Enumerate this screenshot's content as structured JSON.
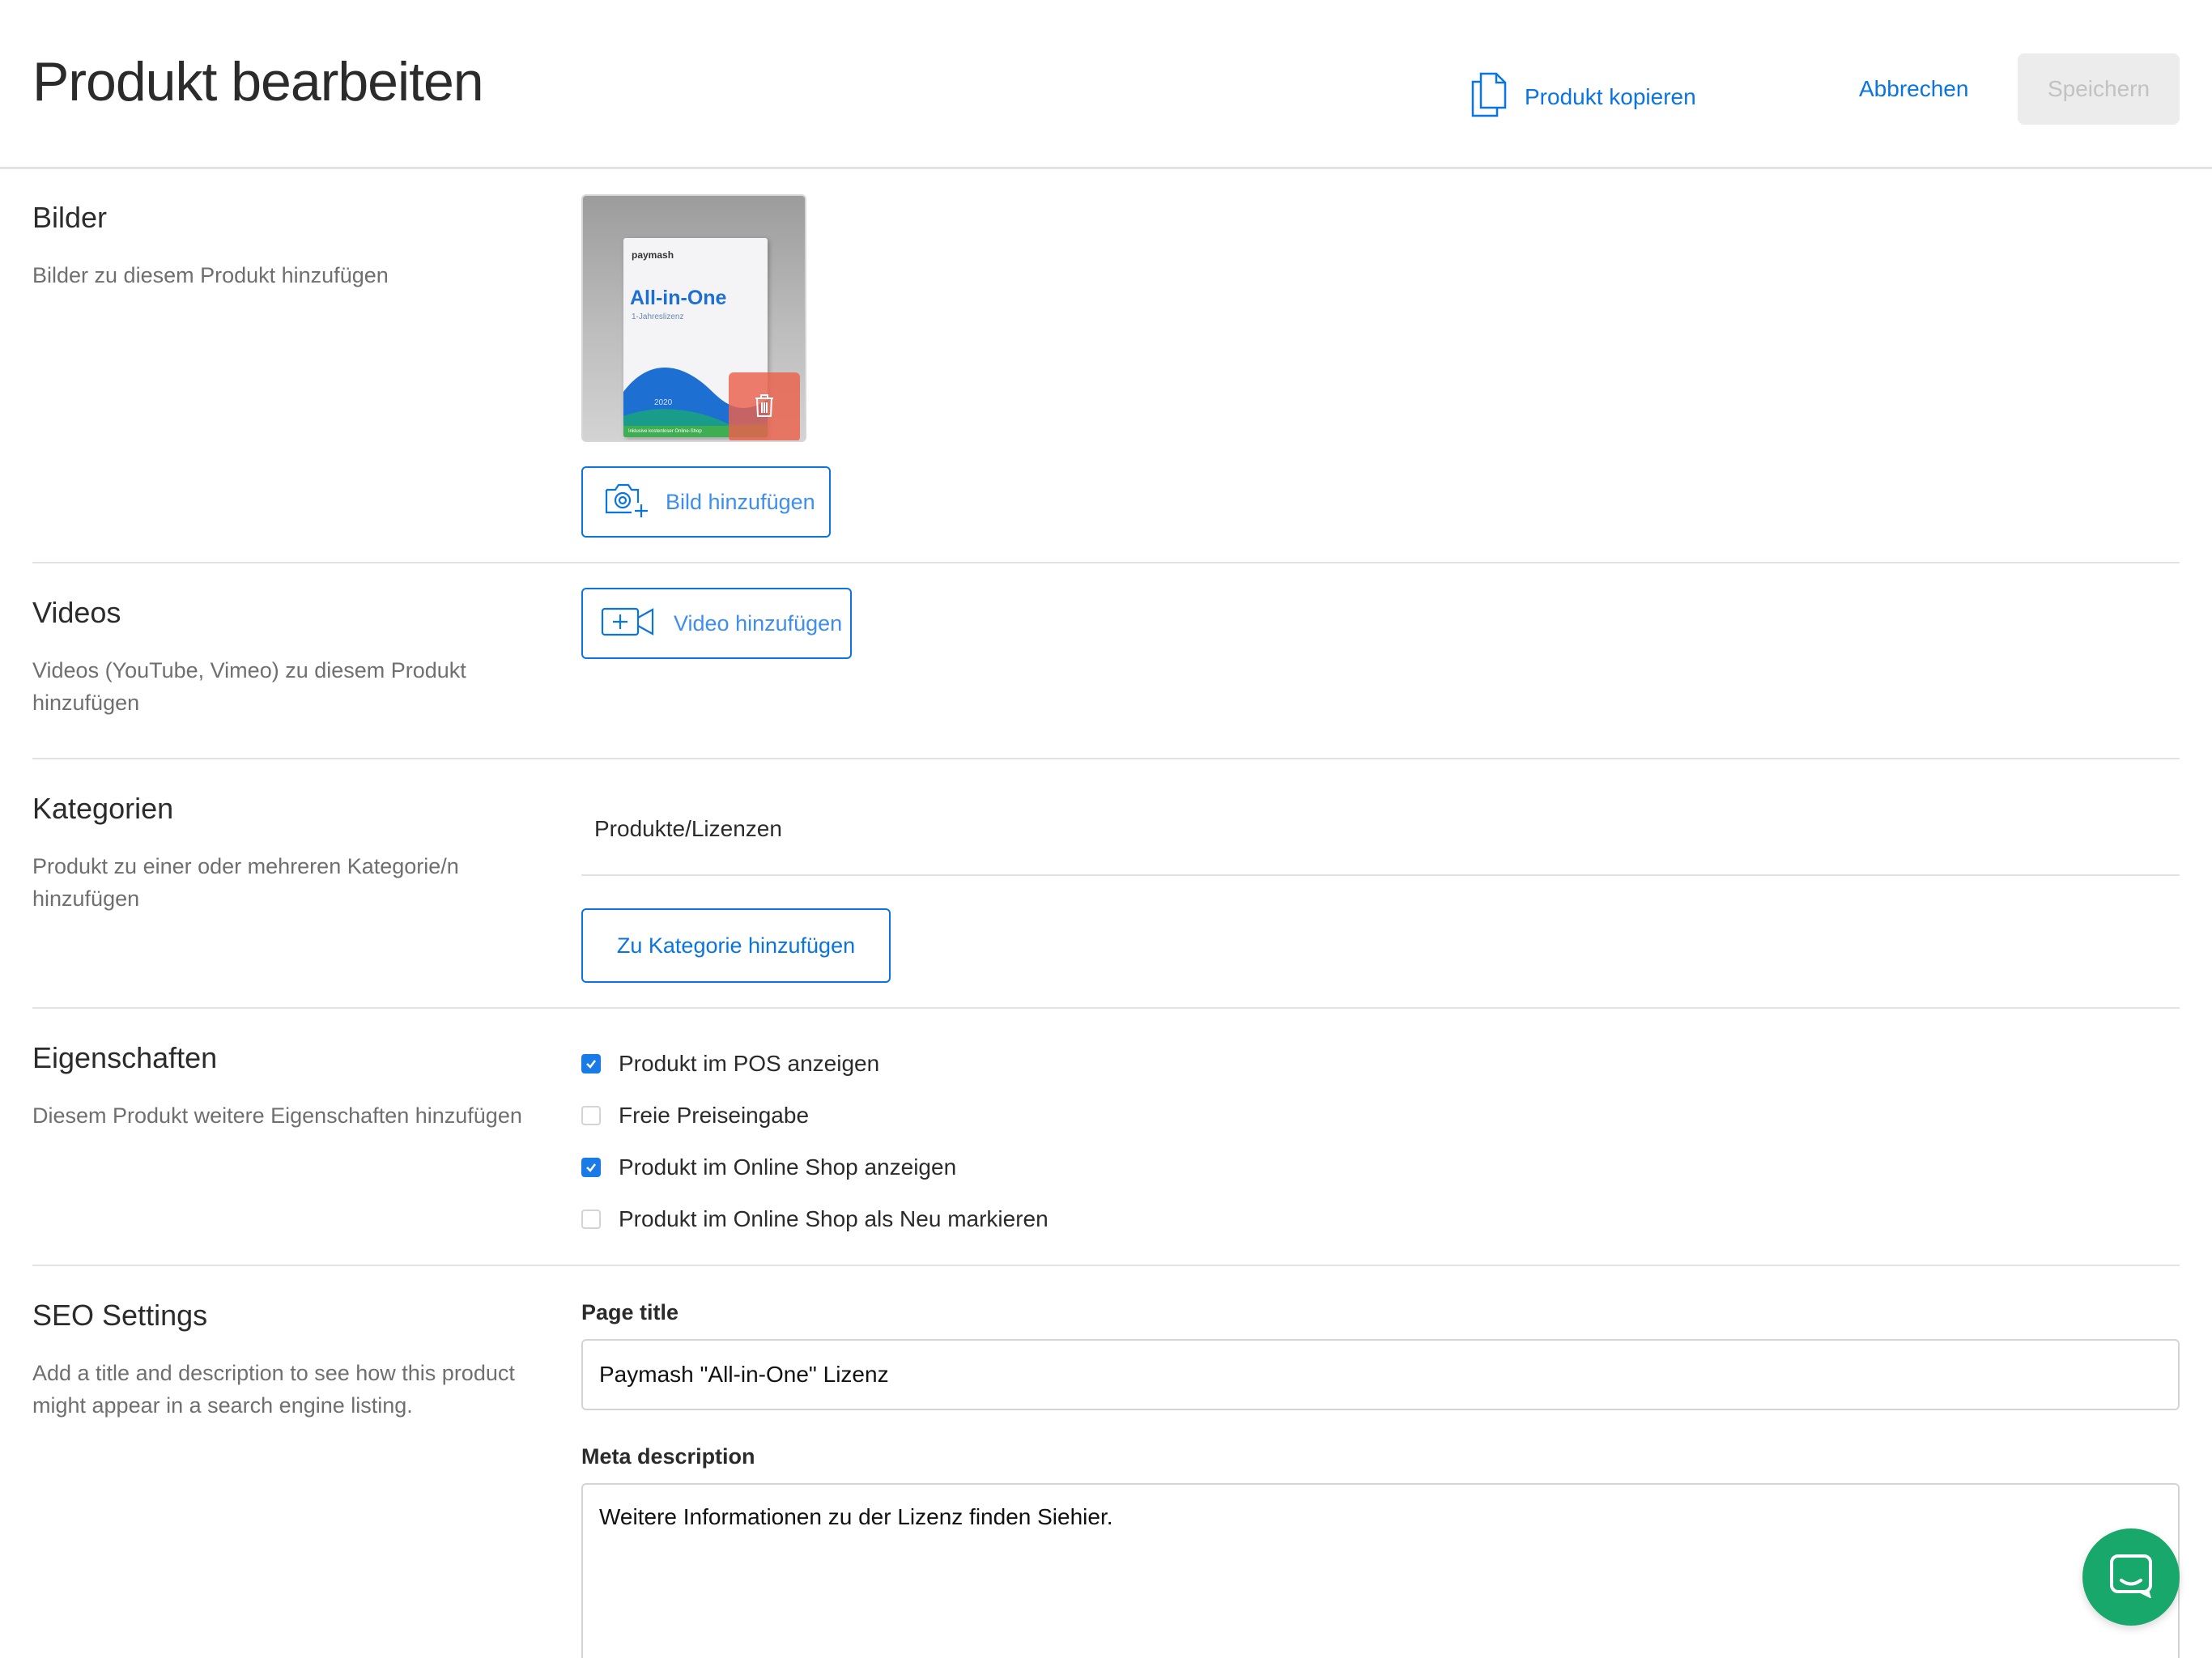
{
  "header": {
    "title": "Produkt bearbeiten",
    "copy_label": "Produkt kopieren",
    "cancel_label": "Abbrechen",
    "save_label": "Speichern"
  },
  "images": {
    "title": "Bilder",
    "description": "Bilder zu diesem Produkt hinzufügen",
    "add_button": "Bild hinzufügen",
    "product_box": {
      "brand": "paymash",
      "name": "All-in-One",
      "subtitle": "1-Jahreslizenz",
      "year": "2020",
      "band_text": "Inklusive kostenloser Online-Shop"
    }
  },
  "videos": {
    "title": "Videos",
    "description": "Videos (YouTube, Vimeo) zu diesem Produkt hinzufügen",
    "add_button": "Video hinzufügen"
  },
  "categories": {
    "title": "Kategorien",
    "description": "Produkt zu einer oder mehreren Kategorie/n hinzufügen",
    "current": "Produkte/Lizenzen",
    "add_button": "Zu Kategorie hinzufügen"
  },
  "properties": {
    "title": "Eigenschaften",
    "description": "Diesem Produkt weitere Eigenschaften hinzufügen",
    "options": [
      {
        "label": "Produkt im POS anzeigen",
        "checked": true
      },
      {
        "label": "Freie Preiseingabe",
        "checked": false
      },
      {
        "label": "Produkt im Online Shop anzeigen",
        "checked": true
      },
      {
        "label": "Produkt im Online Shop als Neu markieren",
        "checked": false
      }
    ]
  },
  "seo": {
    "title": "SEO Settings",
    "description": "Add a title and description to see how this product might appear in a search engine listing.",
    "page_title_label": "Page title",
    "page_title_value": "Paymash \"All-in-One\" Lizenz",
    "meta_label": "Meta description",
    "meta_value": "Weitere Informationen zu der Lizenz finden Siehier."
  },
  "colors": {
    "accent": "#0a74e0",
    "checkbox": "#1a7be6",
    "delete": "#ec604c",
    "chat": "#18a86b"
  },
  "icons": [
    "copy-icon",
    "camera-add-icon",
    "video-add-icon",
    "trash-icon",
    "check-icon",
    "chat-icon"
  ]
}
